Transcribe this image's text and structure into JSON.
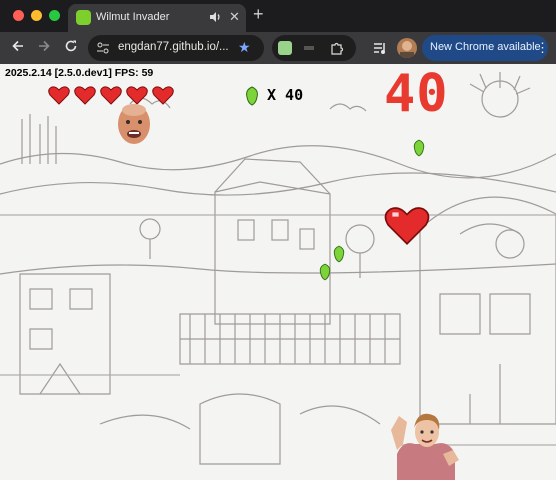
{
  "browser": {
    "tab_title": "Wilmut Invader",
    "tab_close": "✕",
    "new_tab": "+",
    "url": "engdan77.github.io/...",
    "bookmark": "★",
    "update_label": "New Chrome available",
    "menu": "⋮"
  },
  "game": {
    "version_fps": "2025.2.14 [2.5.0.dev1] FPS: 59",
    "lives": 5,
    "score": "40",
    "combo": "X 40",
    "colors": {
      "hearts": "#e42b2b",
      "score": "#e83a2e",
      "enemy": "#7cd33a"
    }
  },
  "icons": [
    "back-icon",
    "forward-icon",
    "reload-icon",
    "site-info-icon",
    "star-icon",
    "extension-icon",
    "media-icon",
    "profile-avatar",
    "menu-icon",
    "audio-icon",
    "close-icon"
  ]
}
